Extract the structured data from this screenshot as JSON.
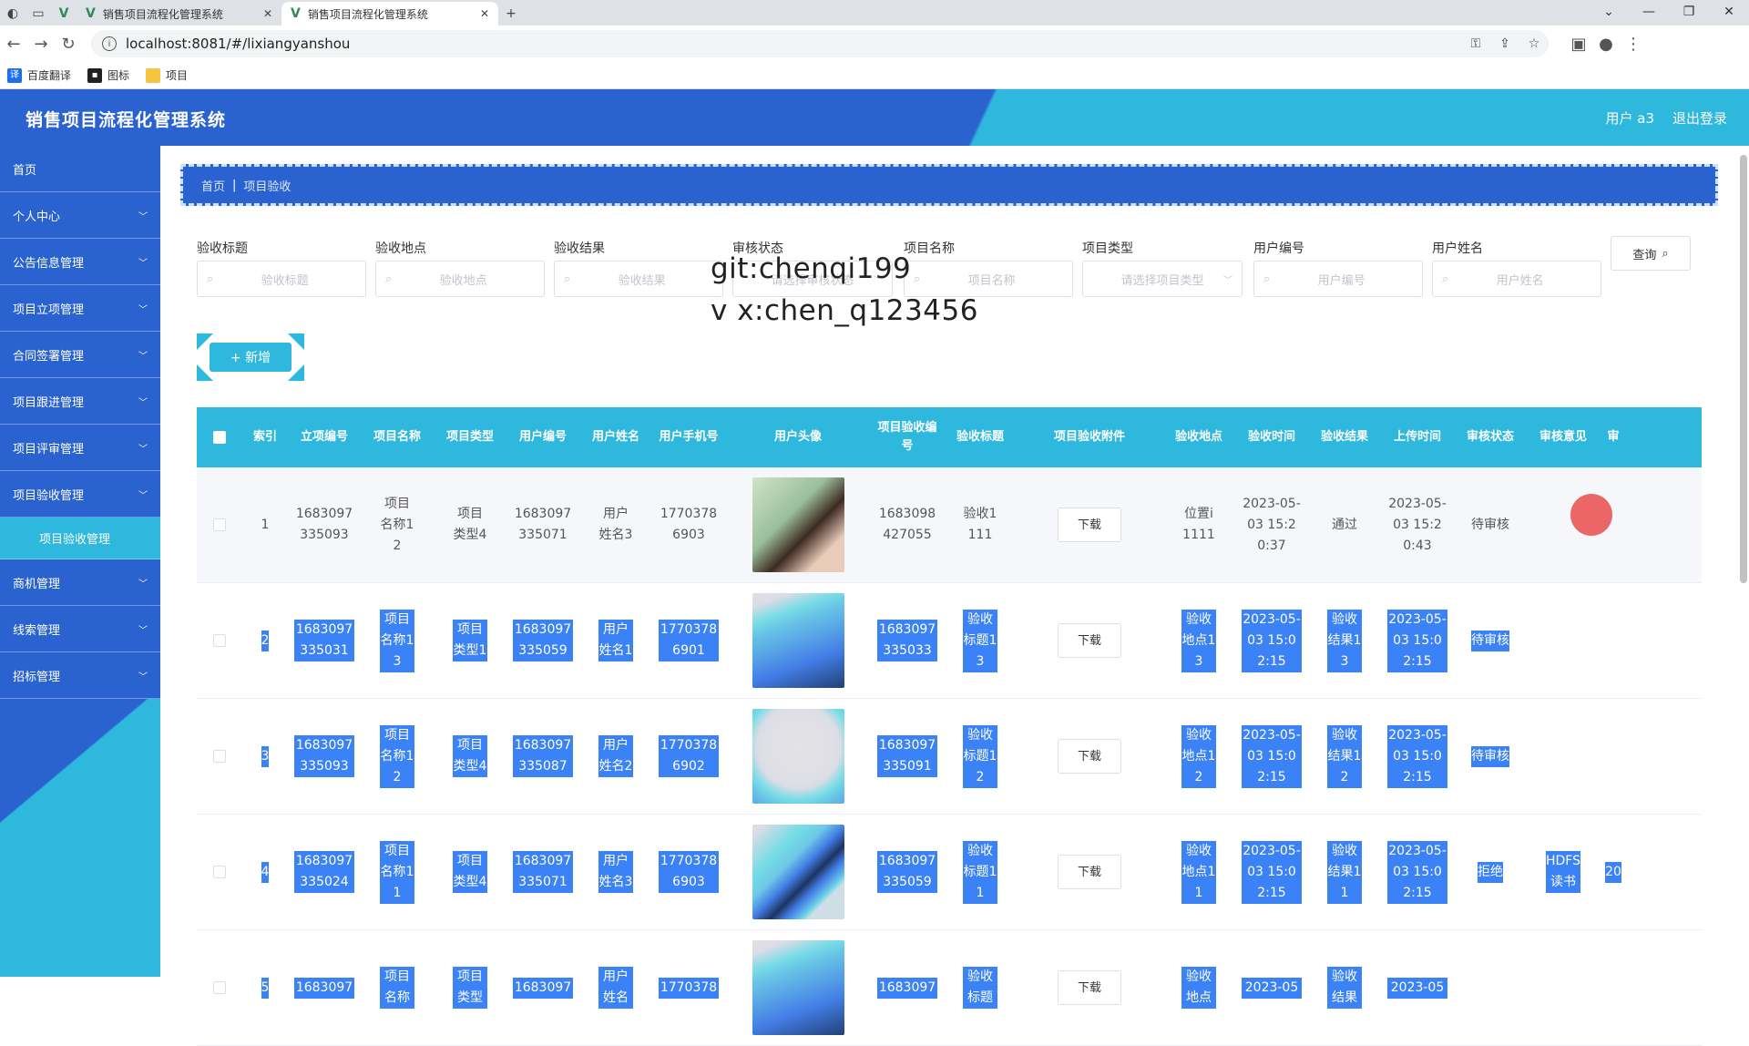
{
  "browser": {
    "tabs": [
      {
        "label": "销售项目流程化管理系统",
        "active": false
      },
      {
        "label": "销售项目流程化管理系统",
        "active": true
      }
    ],
    "new_tab": "+",
    "url": "localhost:8081/#/lixiangyanshou",
    "bookmarks": [
      {
        "label": "百度翻译",
        "color": "#1e6ff0"
      },
      {
        "label": "图标",
        "color": "#222222"
      },
      {
        "label": "项目",
        "color": "#f5c542"
      }
    ]
  },
  "header": {
    "title": "销售项目流程化管理系统",
    "user": "用户 a3",
    "logout": "退出登录"
  },
  "sidebar": {
    "items": [
      {
        "label": "首页",
        "chevron": false
      },
      {
        "label": "个人中心",
        "chevron": true
      },
      {
        "label": "公告信息管理",
        "chevron": true
      },
      {
        "label": "项目立项管理",
        "chevron": true
      },
      {
        "label": "合同签署管理",
        "chevron": true
      },
      {
        "label": "项目跟进管理",
        "chevron": true
      },
      {
        "label": "项目评审管理",
        "chevron": true
      },
      {
        "label": "项目验收管理",
        "chevron": true
      },
      {
        "label": "项目验收管理",
        "sub": true
      },
      {
        "label": "商机管理",
        "chevron": true
      },
      {
        "label": "线索管理",
        "chevron": true
      },
      {
        "label": "招标管理",
        "chevron": true
      }
    ]
  },
  "breadcrumb": {
    "home": "首页",
    "current": "项目验收"
  },
  "search": {
    "fields": [
      {
        "label": "验收标题",
        "placeholder": "验收标题",
        "select": false
      },
      {
        "label": "验收地点",
        "placeholder": "验收地点",
        "select": false
      },
      {
        "label": "验收结果",
        "placeholder": "验收结果",
        "select": false
      },
      {
        "label": "审核状态",
        "placeholder": "请选择审核状态",
        "select": true
      },
      {
        "label": "项目名称",
        "placeholder": "项目名称",
        "select": false
      },
      {
        "label": "项目类型",
        "placeholder": "请选择项目类型",
        "select": true
      },
      {
        "label": "用户编号",
        "placeholder": "用户编号",
        "select": false
      },
      {
        "label": "用户姓名",
        "placeholder": "用户姓名",
        "select": false
      }
    ],
    "query_button": "查询"
  },
  "watermark": {
    "line1": "git:chenqi199",
    "line2": "v x:chen_q123456"
  },
  "add_button": "+ 新增",
  "table": {
    "headers": [
      "索引",
      "立项编号",
      "项目名称",
      "项目类型",
      "用户编号",
      "用户姓名",
      "用户手机号",
      "用户头像",
      "项目验收编号",
      "验收标题",
      "项目验收附件",
      "验收地点",
      "验收时间",
      "验收结果",
      "上传时间",
      "审核状态",
      "审核意见",
      "审"
    ],
    "download_label": "下载",
    "rows": [
      {
        "index": "1",
        "lixiang_no": "1683097335093",
        "project_name": "项目名称12",
        "project_type": "项目类型4",
        "user_no": "1683097335071",
        "user_name": "用户姓名3",
        "phone": "17703786903",
        "avatar": "avatar-girl-photo",
        "acceptance_no": "1683098427055",
        "title": "验收1111",
        "location": "位置i1111",
        "time": "2023-05-03 15:20:37",
        "result": "通过",
        "upload_time": "2023-05-03 15:20:43",
        "status": "待审核",
        "opinion": "",
        "extra": ""
      },
      {
        "index": "2",
        "lixiang_no": "1683097335031",
        "project_name": "项目名称13",
        "project_type": "项目类型1",
        "user_no": "1683097335059",
        "user_name": "用户姓名1",
        "phone": "17703786901",
        "avatar": "avatar-person-photo",
        "acceptance_no": "1683097335033",
        "title": "验收标题13",
        "location": "验收地点13",
        "time": "2023-05-03 15:02:15",
        "result": "验收结果13",
        "upload_time": "2023-05-03 15:02:15",
        "status": "待审核",
        "opinion": "",
        "extra": ""
      },
      {
        "index": "3",
        "lixiang_no": "1683097335093",
        "project_name": "项目名称12",
        "project_type": "项目类型4",
        "user_no": "1683097335087",
        "user_name": "用户姓名2",
        "phone": "17703786902",
        "avatar": "avatar-cartoon",
        "acceptance_no": "1683097335091",
        "title": "验收标题12",
        "location": "验收地点12",
        "time": "2023-05-03 15:02:15",
        "result": "验收结果12",
        "upload_time": "2023-05-03 15:02:15",
        "status": "待审核",
        "opinion": "",
        "extra": ""
      },
      {
        "index": "4",
        "lixiang_no": "1683097335024",
        "project_name": "项目名称11",
        "project_type": "项目类型4",
        "user_no": "1683097335071",
        "user_name": "用户姓名3",
        "phone": "17703786903",
        "avatar": "avatar-girl-photo",
        "acceptance_no": "1683097335059",
        "title": "验收标题11",
        "location": "验收地点11",
        "time": "2023-05-03 15:02:15",
        "result": "验收结果11",
        "upload_time": "2023-05-03 15:02:15",
        "status": "拒绝",
        "opinion": "HDFS读书",
        "extra": "20"
      },
      {
        "index": "5",
        "lixiang_no": "1683097",
        "project_name": "项目名称",
        "project_type": "项目类型",
        "user_no": "1683097",
        "user_name": "用户姓名",
        "phone": "1770378",
        "avatar": "avatar-person-photo",
        "acceptance_no": "1683097",
        "title": "验收标题",
        "location": "验收地点",
        "time": "2023-05",
        "result": "验收结果",
        "upload_time": "2023-05",
        "status": "",
        "opinion": "",
        "extra": ""
      }
    ]
  },
  "colors": {
    "primary": "#2a62cf",
    "accent": "#2eb8dd",
    "highlight": "#3b82f6"
  }
}
